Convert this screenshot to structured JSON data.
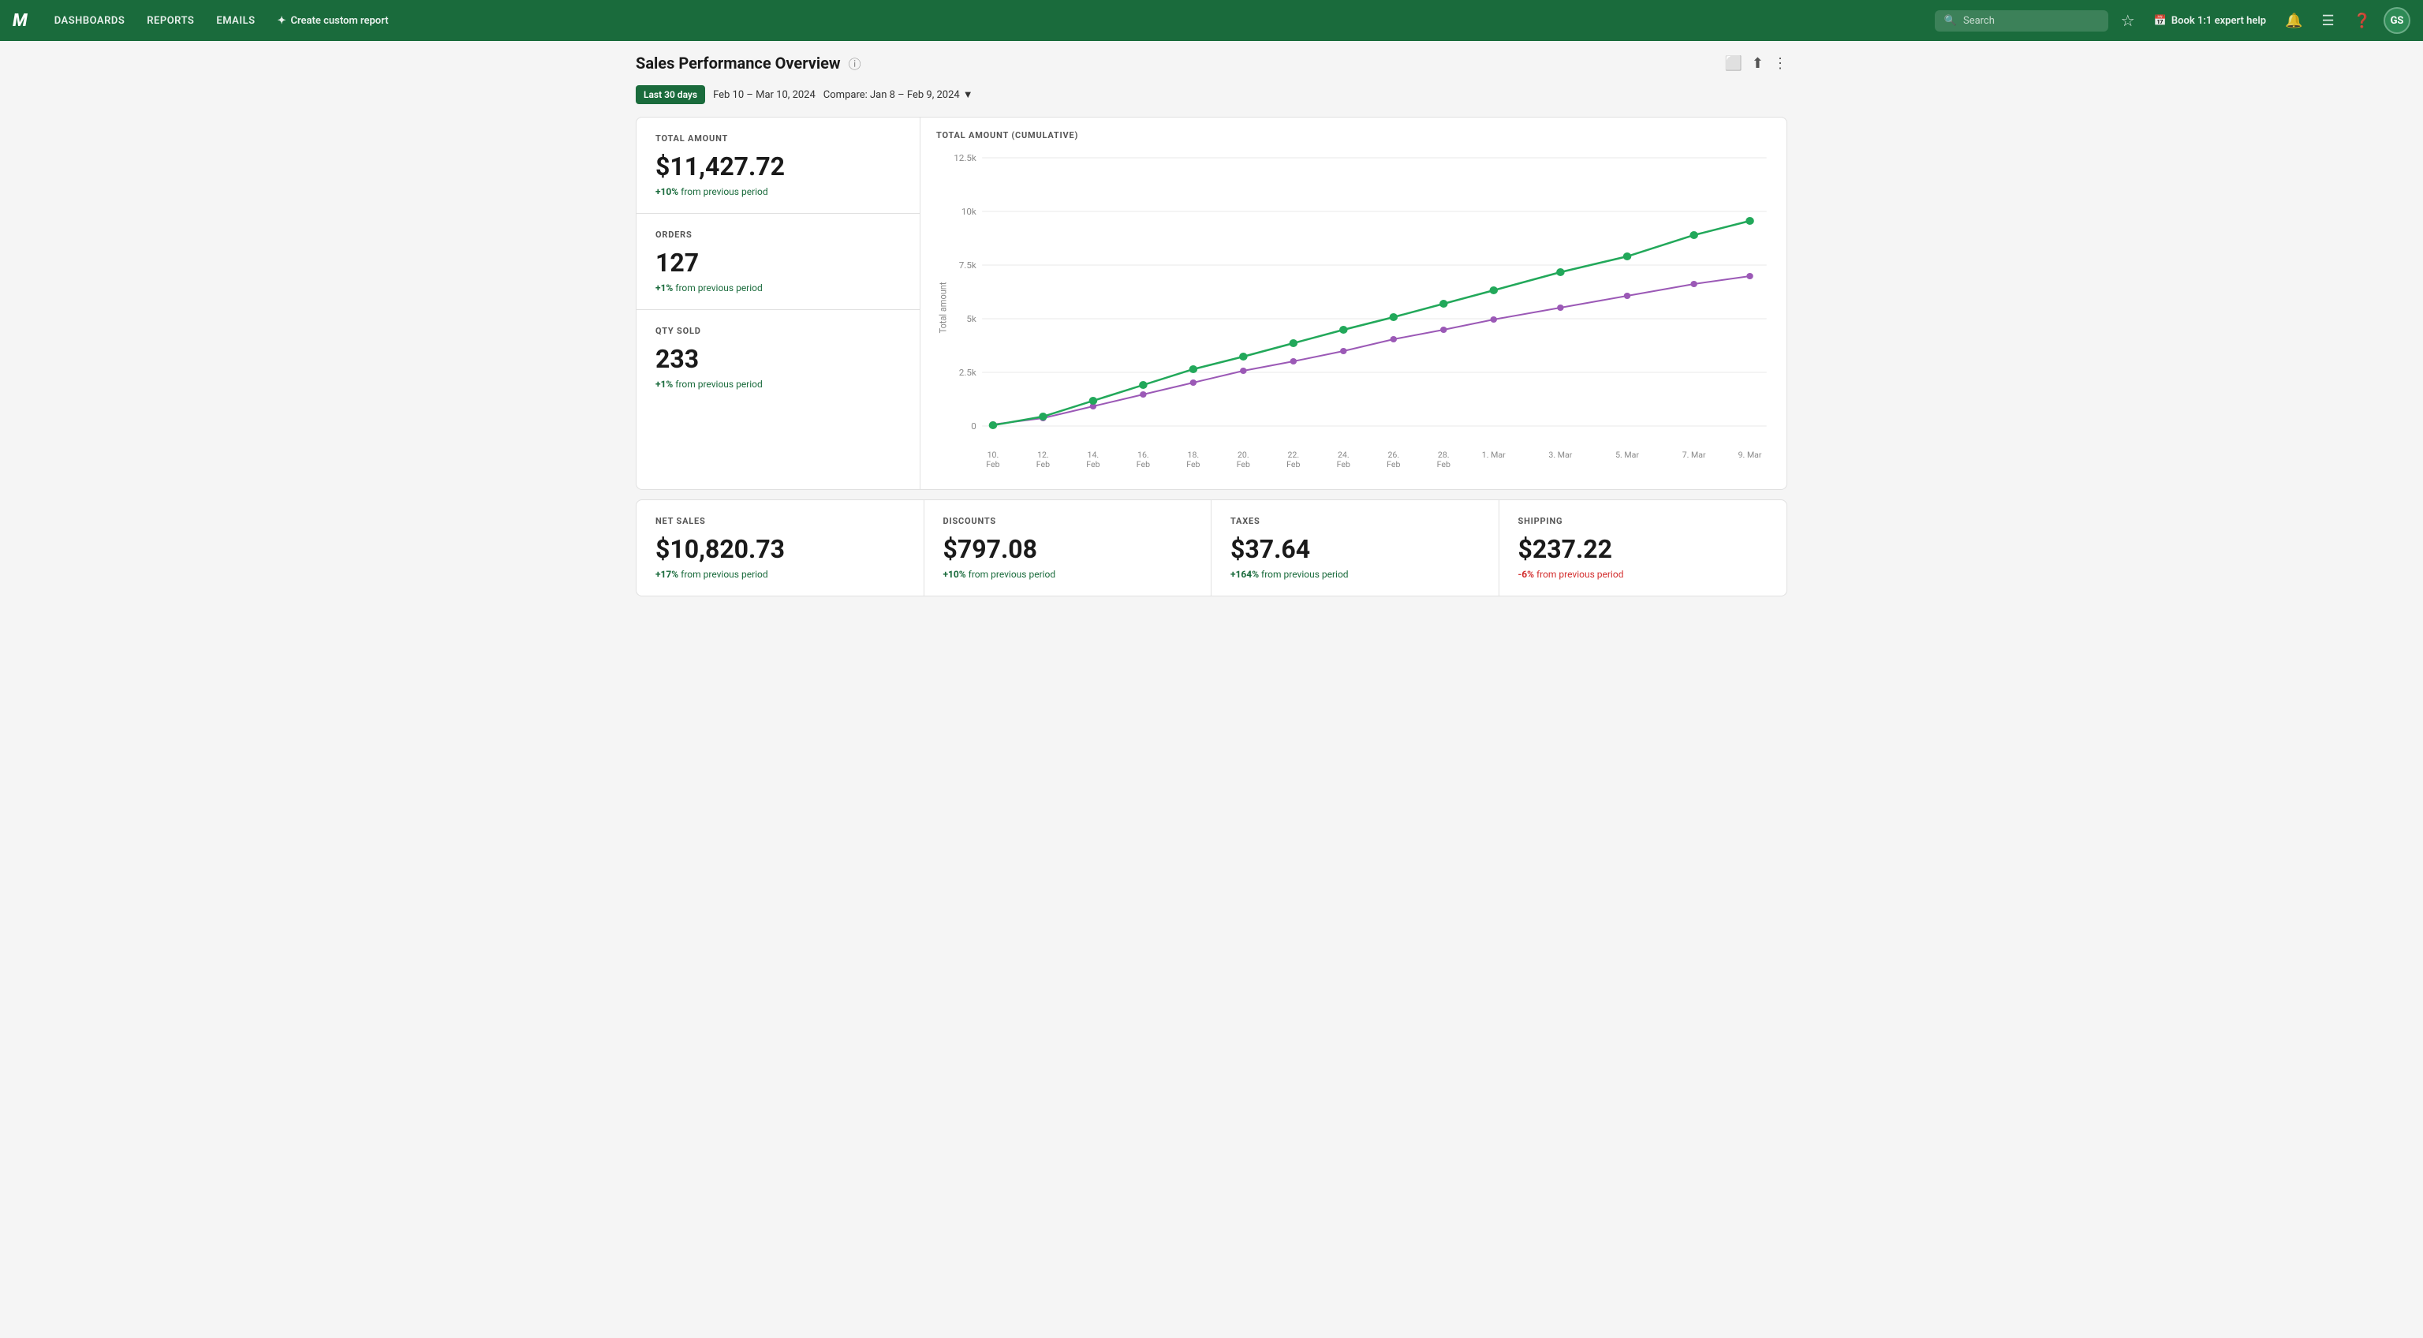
{
  "nav": {
    "logo": "M",
    "links": [
      "DASHBOARDS",
      "REPORTS",
      "EMAILS"
    ],
    "create_label": "Create custom report",
    "search_placeholder": "Search",
    "avatar": "GS"
  },
  "page": {
    "title": "Sales Performance Overview",
    "date_preset": "Last 30 days",
    "date_range": "Feb 10 – Mar 10, 2024",
    "compare_label": "Compare: Jan 8 – Feb 9, 2024"
  },
  "metrics": [
    {
      "label": "TOTAL AMOUNT",
      "value": "$11,427.72",
      "change": "+10%",
      "change_text": " from previous period",
      "positive": true
    },
    {
      "label": "ORDERS",
      "value": "127",
      "change": "+1%",
      "change_text": " from previous period",
      "positive": true
    },
    {
      "label": "QTY SOLD",
      "value": "233",
      "change": "+1%",
      "change_text": " from previous period",
      "positive": true
    }
  ],
  "chart": {
    "title": "TOTAL AMOUNT (CUMULATIVE)",
    "y_labels": [
      "0",
      "2.5k",
      "5k",
      "7.5k",
      "10k",
      "12.5k"
    ],
    "x_labels": [
      "10.\nFeb",
      "12.\nFeb",
      "14.\nFeb",
      "16.\nFeb",
      "18.\nFeb",
      "20.\nFeb",
      "22.\nFeb",
      "24.\nFeb",
      "26.\nFeb",
      "28.\nFeb",
      "1. Mar",
      "3. Mar",
      "5. Mar",
      "7. Mar",
      "9. Mar"
    ],
    "y_axis_label": "Total amount",
    "current_color": "#22a85a",
    "compare_color": "#9b59b6"
  },
  "bottom_stats": [
    {
      "label": "NET SALES",
      "value": "$10,820.73",
      "change": "+17%",
      "change_text": " from previous period",
      "positive": true
    },
    {
      "label": "DISCOUNTS",
      "value": "$797.08",
      "change": "+10%",
      "change_text": " from previous period",
      "positive": true
    },
    {
      "label": "TAXES",
      "value": "$37.64",
      "change": "+164%",
      "change_text": " from previous period",
      "positive": true
    },
    {
      "label": "SHIPPING",
      "value": "$237.22",
      "change": "-6%",
      "change_text": " from previous period",
      "positive": false
    }
  ]
}
